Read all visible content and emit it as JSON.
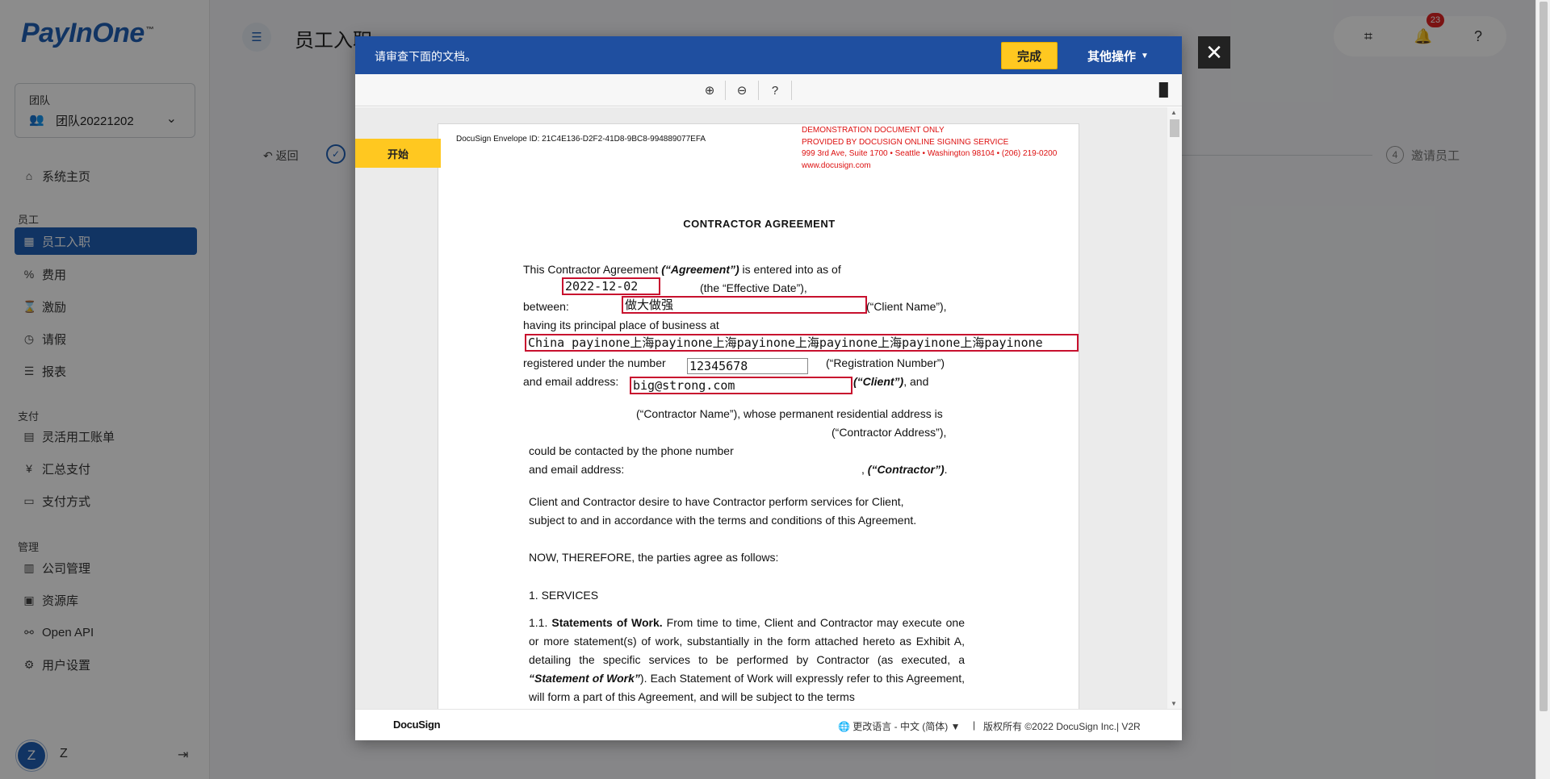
{
  "app": {
    "logo": "PayInOne",
    "logo_tm": "™",
    "page_title": "员工入职",
    "team": {
      "caption": "团队",
      "value": "团队20221202"
    },
    "sections": {
      "employee": "员工",
      "payment": "支付",
      "manage": "管理"
    },
    "nav": {
      "home": "系统主页",
      "onboarding": "员工入职",
      "expense": "费用",
      "incentive": "激励",
      "leave": "请假",
      "report": "报表",
      "flex_bill": "灵活用工账单",
      "summary_pay": "汇总支付",
      "pay_method": "支付方式",
      "company": "公司管理",
      "resources": "资源库",
      "open_api": "Open API",
      "user_settings": "用户设置"
    },
    "user": {
      "initial": "Z",
      "name": "Z"
    },
    "notifications": "23",
    "back": "返回",
    "step4_num": "4",
    "step4_label": "邀请员工"
  },
  "modal": {
    "instruction": "请审查下面的文档。",
    "finish": "完成",
    "other_actions": "其他操作",
    "start_tab": "开始"
  },
  "document": {
    "envelope_id": "DocuSign Envelope ID: 21C4E136-D2F2-41D8-9BC8-994889077EFA",
    "demo_lines": [
      "DEMONSTRATION DOCUMENT ONLY",
      "PROVIDED BY DOCUSIGN ONLINE SIGNING SERVICE",
      "999 3rd Ave, Suite 1700  • Seattle • Washington 98104 • (206) 219-0200",
      "www.docusign.com"
    ],
    "title": "CONTRACTOR AGREEMENT",
    "intro_1": "This Contractor Agreement ",
    "intro_agreement": "(“Agreement”)",
    "intro_2": " is entered into as of",
    "effective_date_label": "(the “Effective Date”),",
    "between_label": "between:",
    "client_name_label": "(“Client Name”),",
    "principal_place": "having its principal place of business at",
    "registered_label": "registered under the number",
    "registration_number_label": "(“Registration Number”)",
    "email_label": "and email address:",
    "client_label": "(“Client”)",
    "client_and": ", and",
    "contractor_name_line": "(“Contractor Name”), whose permanent residential address is",
    "contractor_address_line": "(“Contractor Address”),",
    "phone_line": "could be contacted by the phone number",
    "contractor_email_label": "and email address:",
    "contractor_comma": ", ",
    "contractor_label": "(“Contractor”)",
    "contractor_dot": ".",
    "desire_1": "Client and Contractor desire to have Contractor perform services for Client,",
    "desire_2": "subject to and in accordance with the terms and conditions of this Agreement.",
    "therefore": "NOW, THEREFORE, the parties agree as follows:",
    "section_1": "1. SERVICES",
    "s11_num": "1.1.",
    "s11_title": "Statements of Work.",
    "s11_text_1": " From time to time, Client and Contractor may execute one or more statement(s) of work, substantially in the form attached hereto as Exhibit A, detailing the specific services to be performed by Contractor (as executed, a ",
    "s11_sow": "“Statement of Work”",
    "s11_text_2": "). Each Statement of Work will expressly refer to this Agreement, will form a part of this Agreement, and will be subject to the terms",
    "fields": {
      "effective_date": "2022-12-02",
      "client_name": "做大做强",
      "address": "China payinone上海payinone上海payinone上海payinone上海payinone上海payinone",
      "registration_number": "12345678",
      "email": "big@strong.com"
    }
  },
  "footer": {
    "logo": "DocuSign",
    "language": "更改语言 - 中文 (简体)",
    "separator": "|",
    "copyright": "版权所有 ©2022 DocuSign Inc.|  V2R"
  }
}
